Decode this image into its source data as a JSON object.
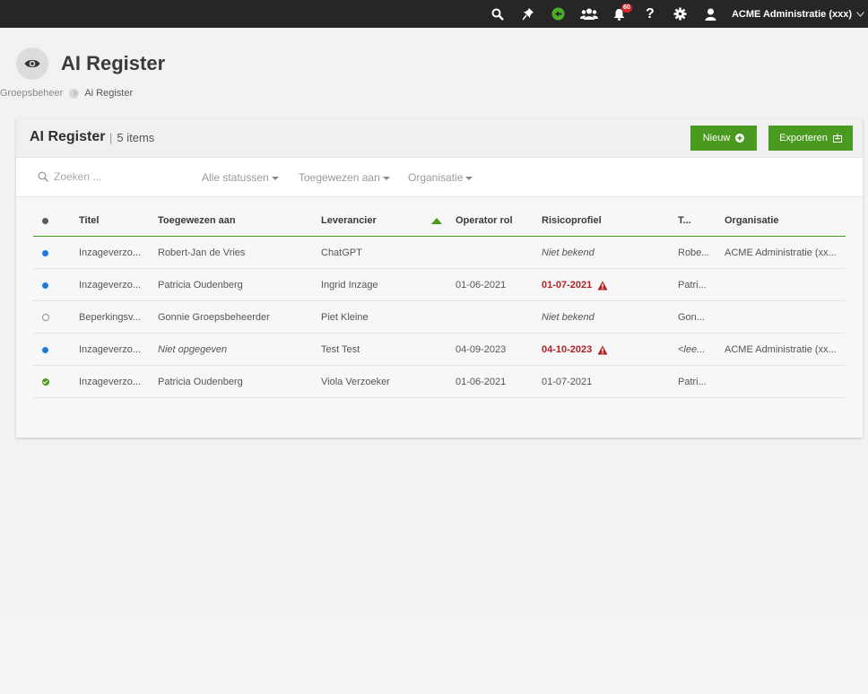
{
  "topbar": {
    "icons": [
      "search-icon",
      "pin-icon",
      "logo-icon",
      "users-icon",
      "bell-icon",
      "help-icon",
      "gear-icon",
      "user-icon"
    ],
    "notification_count": "60",
    "account_name": "ACME Administratie (xxx)"
  },
  "header": {
    "title": "AI Register",
    "breadcrumb": [
      "Groepsbeheer",
      "Ai Register"
    ]
  },
  "panel": {
    "title": "AI Register",
    "count": "5 items",
    "new_label": "Nieuw",
    "export_label": "Exporteren"
  },
  "filters": {
    "search_placeholder": "Zoeken ...",
    "status": "Alle statussen",
    "assigned": "Toegewezen aan",
    "organisation": "Organisatie"
  },
  "table": {
    "headers": {
      "titel": "Titel",
      "toegewezen": "Toegewezen aan",
      "leverancier": "Leverancier",
      "operator": "Operator rol",
      "risico": "Risicoprofiel",
      "t": "T...",
      "organisatie": "Organisatie"
    },
    "rows": [
      {
        "status": "blue",
        "titel": "Inzageverzo...",
        "toegewezen": "Robert-Jan de Vries",
        "leverancier": "ChatGPT",
        "operator": "",
        "risico": "Niet bekend",
        "t": "Robe...",
        "organisatie": "ACME Administratie (xx..."
      },
      {
        "status": "blue",
        "titel": "Inzageverzo...",
        "toegewezen": "Patricia Oudenberg",
        "leverancier": "Ingrid Inzage",
        "operator": "01-06-2021",
        "risico": "01-07-2021",
        "t": "Patri...",
        "organisatie": ""
      },
      {
        "status": "empty",
        "titel": "Beperkingsv...",
        "toegewezen": "Gonnie Groepsbeheerder",
        "leverancier": "Piet Kleine",
        "operator": "",
        "risico": "Niet bekend",
        "t": "Gon...",
        "organisatie": ""
      },
      {
        "status": "blue",
        "titel": "Inzageverzo...",
        "toegewezen": "Niet opgegeven",
        "leverancier": "Test Test",
        "operator": "04-09-2023",
        "risico": "04-10-2023",
        "t": "<lee...",
        "organisatie": "ACME Administratie (xx..."
      },
      {
        "status": "green",
        "titel": "Inzageverzo...",
        "toegewezen": "Patricia Oudenberg",
        "leverancier": "Viola Verzoeker",
        "operator": "01-06-2021",
        "risico": "01-07-2021",
        "t": "Patri...",
        "organisatie": ""
      }
    ]
  },
  "colors": {
    "accent": "#4a9a1f",
    "topbar": "#262626",
    "status_blue": "#1f7ae0",
    "warning_red": "#b02024"
  }
}
